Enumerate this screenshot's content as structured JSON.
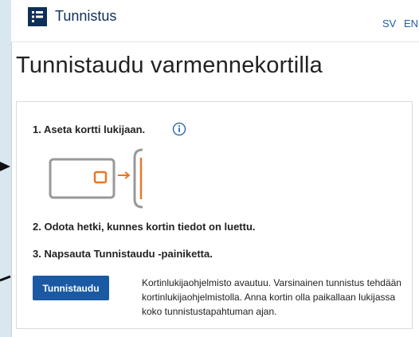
{
  "header": {
    "brand": "Tunnistus",
    "languages": [
      "SV",
      "EN"
    ]
  },
  "page": {
    "title": "Tunnistaudu varmennekortilla"
  },
  "steps": [
    "1. Aseta kortti lukijaan.",
    "2. Odota hetki, kunnes kortin tiedot on luettu.",
    "3. Napsauta Tunnistaudu -painiketta."
  ],
  "button": {
    "label": "Tunnistaudu"
  },
  "help_text": "Kortinlukijaohjelmisto avautuu. Varsinainen tunnistus tehdään kortinlukijaohjelmistolla. Anna kortin olla paikallaan lukijassa koko tunnistustapahtuman ajan.",
  "colors": {
    "brand": "#0e2f57",
    "button": "#1b5aa3",
    "accent": "#e8762b",
    "link": "#1a5fa6"
  }
}
